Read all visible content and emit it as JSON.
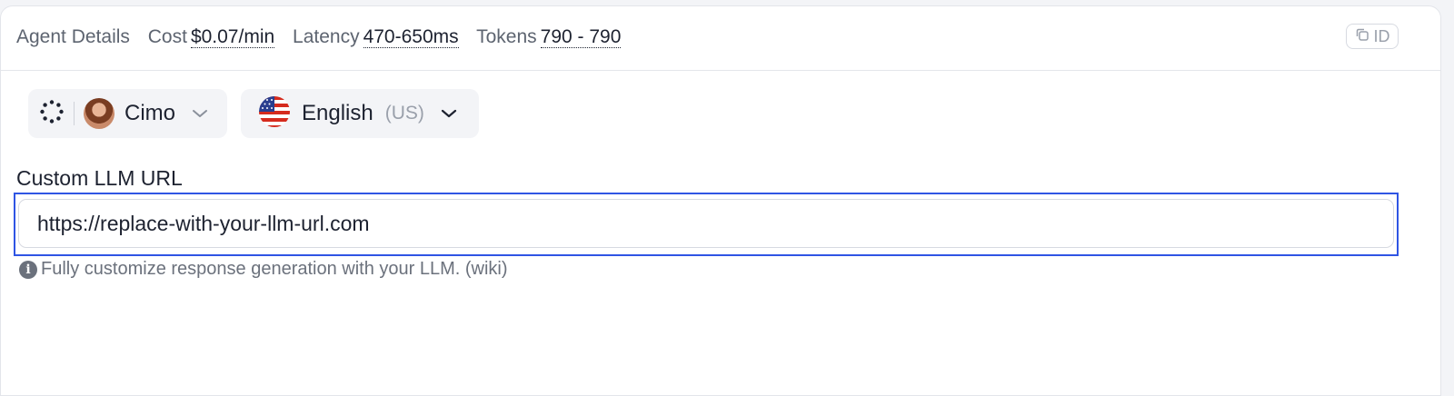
{
  "topbar": {
    "title": "Agent Details",
    "cost_label": "Cost",
    "cost_value": "$0.07/min",
    "latency_label": "Latency",
    "latency_value": "470-650ms",
    "tokens_label": "Tokens",
    "tokens_value": "790 - 790",
    "id_button_label": "ID",
    "id_button_icon": "copy-icon"
  },
  "voice_selector": {
    "icon": "dotted-circle-icon",
    "name": "Cimo",
    "chevron_icon": "chevron-down-icon"
  },
  "language_selector": {
    "flag_icon": "us-flag-icon",
    "name": "English",
    "region": "(US)",
    "chevron_icon": "chevron-down-icon"
  },
  "custom_llm": {
    "label": "Custom LLM URL",
    "value": "https://replace-with-your-llm-url.com",
    "help_icon": "info-icon",
    "help_text": "Fully customize response generation with your LLM. (wiki)"
  },
  "colors": {
    "accent": "#2f55e4",
    "text": "#1d2230",
    "muted": "#5d6470",
    "pill_bg": "#f3f4f7"
  }
}
